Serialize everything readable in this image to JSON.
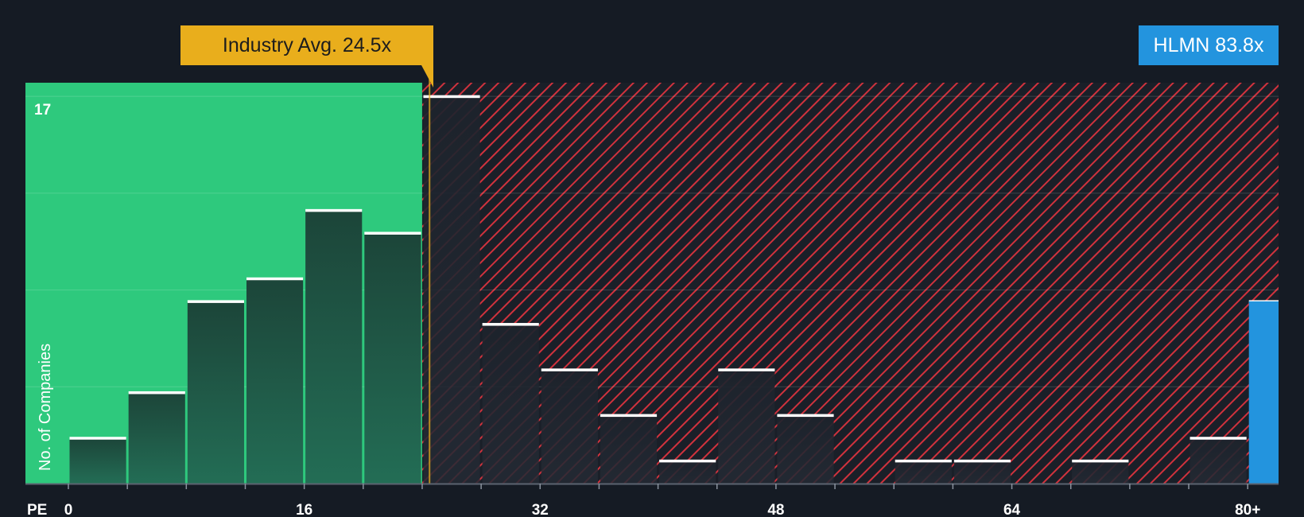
{
  "chart_data": {
    "type": "bar",
    "xlabel": "PE",
    "ylabel": "No. of Companies",
    "ymax_label": "17",
    "x_ticks": [
      {
        "value": 0,
        "label": "0"
      },
      {
        "value": 16,
        "label": "16"
      },
      {
        "value": 32,
        "label": "32"
      },
      {
        "value": 48,
        "label": "48"
      },
      {
        "value": 64,
        "label": "64"
      },
      {
        "value": 80,
        "label": "80+"
      }
    ],
    "bin_width": 4,
    "ylim": [
      0,
      17.6
    ],
    "gridlines": [
      4.25,
      8.5,
      12.75,
      17
    ],
    "bins": [
      {
        "x0": 0,
        "count": 2
      },
      {
        "x0": 4,
        "count": 4
      },
      {
        "x0": 8,
        "count": 8
      },
      {
        "x0": 12,
        "count": 9
      },
      {
        "x0": 16,
        "count": 12
      },
      {
        "x0": 20,
        "count": 11
      },
      {
        "x0": 24,
        "count": 17
      },
      {
        "x0": 28,
        "count": 7
      },
      {
        "x0": 32,
        "count": 5
      },
      {
        "x0": 36,
        "count": 3
      },
      {
        "x0": 40,
        "count": 1
      },
      {
        "x0": 44,
        "count": 5
      },
      {
        "x0": 48,
        "count": 3
      },
      {
        "x0": 52,
        "count": 0
      },
      {
        "x0": 56,
        "count": 1
      },
      {
        "x0": 60,
        "count": 1
      },
      {
        "x0": 64,
        "count": 0
      },
      {
        "x0": 68,
        "count": 1
      },
      {
        "x0": 72,
        "count": 0
      },
      {
        "x0": 76,
        "count": 2
      },
      {
        "x0": 80,
        "count": 8
      }
    ],
    "industry_avg": {
      "value": 24.5,
      "label": "Industry Avg. 24.5x"
    },
    "company": {
      "ticker": "HLMN",
      "value": 83.8,
      "label": "HLMN 83.8x"
    },
    "colors": {
      "background": "#151b24",
      "below_avg_region": "#2ec97d",
      "below_avg_bar": "#1e4a3c",
      "above_avg_hatch": "#d0323d",
      "above_avg_bar": "#1c222b",
      "company_bar": "#2394de",
      "bar_cap": "#ffffff",
      "industry_callout": "#e9ae1c",
      "company_callout": "#2394de"
    }
  }
}
